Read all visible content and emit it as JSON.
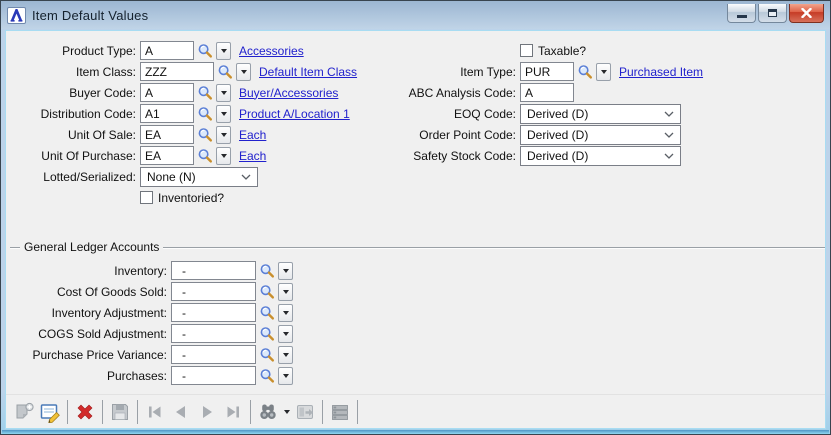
{
  "window": {
    "title": "Item Default Values",
    "icon_letter": "A",
    "controls": [
      "minimize-icon",
      "restore-icon",
      "close-icon"
    ]
  },
  "fields": {
    "product_type": {
      "label": "Product Type:",
      "value": "A",
      "link": "Accessories"
    },
    "item_class": {
      "label": "Item Class:",
      "value": "ZZZ",
      "link": "Default Item Class"
    },
    "buyer_code": {
      "label": "Buyer Code:",
      "value": "A",
      "link": "Buyer/Accessories"
    },
    "distribution_code": {
      "label": "Distribution Code:",
      "value": "A1",
      "link": "Product A/Location 1"
    },
    "unit_of_sale": {
      "label": "Unit Of Sale:",
      "value": "EA",
      "link": "Each"
    },
    "unit_of_purchase": {
      "label": "Unit Of Purchase:",
      "value": "EA",
      "link": "Each"
    },
    "lotted_serialized": {
      "label": "Lotted/Serialized:",
      "value": "None (N)"
    },
    "inventoried": {
      "label": "Inventoried?",
      "checked": false
    },
    "taxable": {
      "label": "Taxable?",
      "checked": false
    },
    "item_type": {
      "label": "Item Type:",
      "value": "PUR",
      "link": "Purchased Item"
    },
    "abc_analysis_code": {
      "label": "ABC Analysis Code:",
      "value": "A"
    },
    "eoq_code": {
      "label": "EOQ Code:",
      "value": "Derived (D)"
    },
    "order_point_code": {
      "label": "Order Point Code:",
      "value": "Derived (D)"
    },
    "safety_stock_code": {
      "label": "Safety Stock Code:",
      "value": "Derived (D)"
    }
  },
  "gl": {
    "legend": "General Ledger Accounts",
    "inventory": {
      "label": "Inventory:",
      "value": "-"
    },
    "cost_of_goods_sold": {
      "label": "Cost Of Goods Sold:",
      "value": "-"
    },
    "inventory_adjustment": {
      "label": "Inventory Adjustment:",
      "value": "-"
    },
    "cogs_sold_adjustment": {
      "label": "COGS Sold Adjustment:",
      "value": "-"
    },
    "purchase_price_variance": {
      "label": "Purchase Price Variance:",
      "value": "-"
    },
    "purchases": {
      "label": "Purchases:",
      "value": "-"
    }
  },
  "toolbar": {
    "buttons": [
      {
        "icon": "new-record-icon",
        "enabled": false
      },
      {
        "icon": "edit-record-icon",
        "enabled": true
      },
      {
        "icon": "delete-record-icon",
        "enabled": true
      },
      {
        "icon": "save-record-icon",
        "enabled": false
      },
      {
        "icon": "first-record-icon",
        "enabled": false
      },
      {
        "icon": "previous-record-icon",
        "enabled": false
      },
      {
        "icon": "next-record-icon",
        "enabled": false
      },
      {
        "icon": "last-record-icon",
        "enabled": false
      },
      {
        "icon": "find-binoculars-icon",
        "enabled": true
      },
      {
        "icon": "drilldown-icon",
        "enabled": false
      },
      {
        "icon": "finder-list-icon",
        "enabled": true
      }
    ]
  },
  "icons": {
    "lookup": "magnifier-icon",
    "dropdown": "dropdown-arrow-icon",
    "combo": "chevron-down-icon"
  },
  "colors": {
    "titlebar_top": "#9cb6d2",
    "titlebar_bottom": "#c0d4e7",
    "background": "#f0f0f0",
    "link": "#2121cd",
    "close_button": "#c53b25",
    "delete_icon": "#d22b2b",
    "pencil_icon": "#f2c238",
    "magnifier_rim": "#5b7fd6",
    "magnifier_handle": "#c98f2d"
  }
}
